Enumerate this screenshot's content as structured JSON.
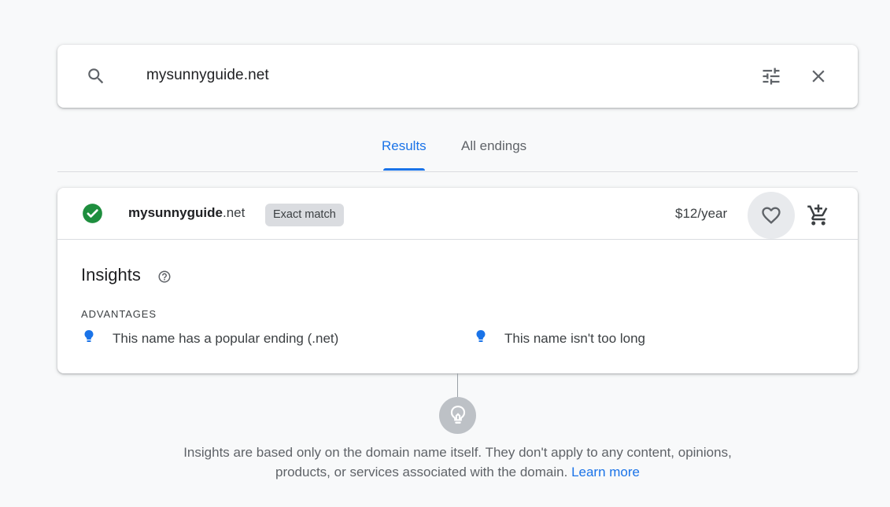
{
  "search": {
    "query": "mysunnyguide.net",
    "search_icon": "search-icon",
    "filter_icon": "tune-icon",
    "close_icon": "close-icon"
  },
  "tabs": [
    {
      "label": "Results",
      "active": true
    },
    {
      "label": "All endings",
      "active": false
    }
  ],
  "result": {
    "status_icon": "check-circle-icon",
    "domain_sld": "mysunnyguide",
    "domain_tld": ".net",
    "badge": "Exact match",
    "price": "$12/year",
    "favorite_icon": "heart-icon",
    "cart_icon": "add-to-cart-icon"
  },
  "insights": {
    "title": "Insights",
    "help_icon": "help-circle-icon",
    "advantages_label": "ADVANTAGES",
    "advantages": [
      "This name has a popular ending (.net)",
      "This name isn't too long"
    ]
  },
  "footer": {
    "icon": "lightbulb-icon",
    "text": "Insights are based only on the domain name itself. They don't apply to any content, opinions, products, or services associated with the domain.",
    "link": "Learn more"
  },
  "colors": {
    "accent": "#1a73e8",
    "success": "#1e8e3e",
    "bulb": "#1a73e8",
    "background": "#f8f9fa"
  }
}
